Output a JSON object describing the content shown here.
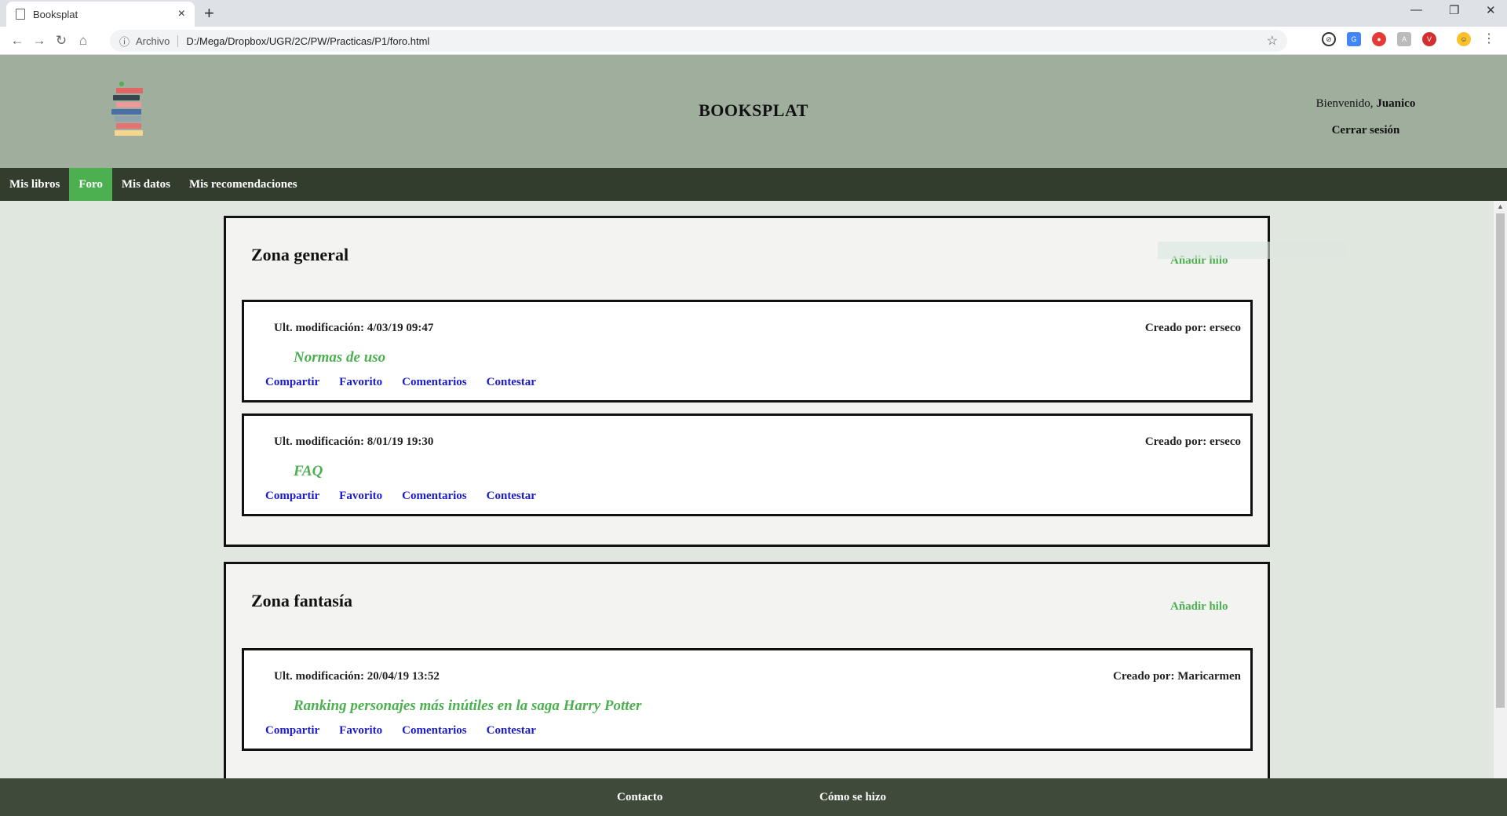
{
  "browser": {
    "tab_title": "Booksplat",
    "tab_close": "×",
    "new_tab": "+",
    "address_proto": "Archivo",
    "address_url": "D:/Mega/Dropbox/UGR/2C/PW/Practicas/P1/foro.html"
  },
  "header": {
    "title": "BOOKSPLAT",
    "welcome_prefix": "Bienvenido, ",
    "welcome_user": "Juanico",
    "logout": "Cerrar sesión"
  },
  "nav": {
    "items": [
      {
        "label": "Mis libros",
        "active": false
      },
      {
        "label": "Foro",
        "active": true
      },
      {
        "label": "Mis datos",
        "active": false
      },
      {
        "label": "Mis recomendaciones",
        "active": false
      }
    ]
  },
  "zones": [
    {
      "title": "Zona general",
      "add_thread": "Añadir hilo",
      "threads": [
        {
          "modified": "Ult. modificación: 4/03/19 09:47",
          "creator": "Creado por: erseco",
          "title": "Normas de uso"
        },
        {
          "modified": "Ult. modificación: 8/01/19 19:30",
          "creator": "Creado por: erseco",
          "title": "FAQ"
        }
      ]
    },
    {
      "title": "Zona fantasía",
      "add_thread": "Añadir hilo",
      "threads": [
        {
          "modified": "Ult. modificación: 20/04/19 13:52",
          "creator": "Creado por: Maricarmen",
          "title": "Ranking personajes más inútiles en la saga Harry Potter"
        }
      ]
    }
  ],
  "actions": {
    "share": "Compartir",
    "favorite": "Favorito",
    "comments": "Comentarios",
    "reply": "Contestar"
  },
  "footer": {
    "contact": "Contacto",
    "how_made": "Cómo se hizo"
  },
  "colors": {
    "header_bg": "#a0ae9e",
    "nav_bg": "#333d2e",
    "accent_green": "#4caf50",
    "link_blue": "#1a1acd",
    "footer_bg": "#3f4a3a"
  }
}
